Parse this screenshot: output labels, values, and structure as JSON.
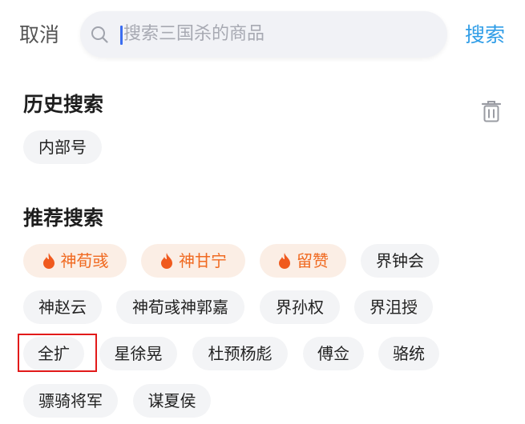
{
  "header": {
    "cancel_label": "取消",
    "search_placeholder": "搜索三国杀的商品",
    "search_label": "搜索"
  },
  "history": {
    "title": "历史搜索",
    "items": [
      "内部号"
    ]
  },
  "recommend": {
    "title": "推荐搜索",
    "hot_items": [
      "神荀彧",
      "神甘宁",
      "留赞"
    ],
    "items": [
      "界钟会",
      "神赵云",
      "神荀彧神郭嘉",
      "界孙权",
      "界沮授",
      "全扩",
      "星徐晃",
      "杜预杨彪",
      "傅佥",
      "骆统",
      "骠骑将军",
      "谋夏侯"
    ]
  },
  "colors": {
    "accent": "#2f9de7",
    "hot_text": "#f06a21",
    "hot_bg": "#fbeee5",
    "tag_bg": "#f3f4f6",
    "highlight": "#e21a1a"
  },
  "icons": [
    "search-icon",
    "trash-icon",
    "fire-icon"
  ]
}
